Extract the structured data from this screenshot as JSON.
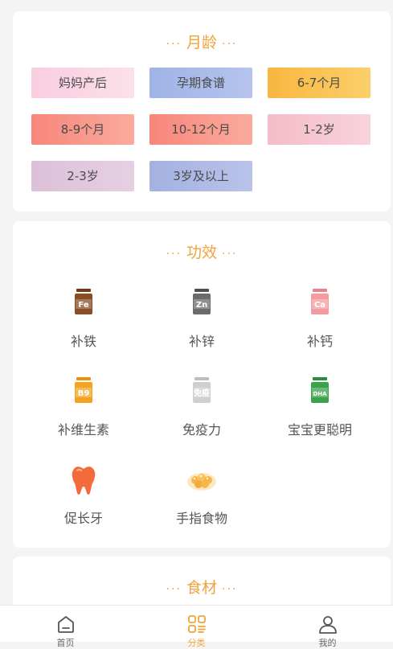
{
  "age_section": {
    "title": "月龄",
    "chips": [
      {
        "label": "妈妈产后",
        "color_from": "#f9cde0",
        "color_to": "#fbe0ea"
      },
      {
        "label": "孕期食谱",
        "color_from": "#9fb3e6",
        "color_to": "#b6c4ee"
      },
      {
        "label": "6-7个月",
        "color_from": "#f9b640",
        "color_to": "#fbcf6a"
      },
      {
        "label": "8-9个月",
        "color_from": "#f7867a",
        "color_to": "#fbaa9e"
      },
      {
        "label": "10-12个月",
        "color_from": "#f7867a",
        "color_to": "#fbaa9e"
      },
      {
        "label": "1-2岁",
        "color_from": "#f4bcc8",
        "color_to": "#f8d3dc"
      },
      {
        "label": "2-3岁",
        "color_from": "#dcc0d9",
        "color_to": "#e6cfe2"
      },
      {
        "label": "3岁及以上",
        "color_from": "#a4b1e0",
        "color_to": "#b9c3ea"
      }
    ]
  },
  "effect_section": {
    "title": "功效",
    "items": [
      {
        "label": "补铁",
        "icon": "iron-bottle-icon",
        "badge": "Fe",
        "color": "#8a4d24",
        "cap": "#6e3a18"
      },
      {
        "label": "补锌",
        "icon": "zinc-bottle-icon",
        "badge": "Zn",
        "color": "#6b6b6b",
        "cap": "#4f4f4f"
      },
      {
        "label": "补钙",
        "icon": "calcium-bottle-icon",
        "badge": "Ca",
        "color": "#f59aa1",
        "cap": "#ee8188"
      },
      {
        "label": "补维生素",
        "icon": "vitamin-bottle-icon",
        "badge": "B9",
        "color": "#f4a321",
        "cap": "#e99210"
      },
      {
        "label": "免疫力",
        "icon": "immunity-bottle-icon",
        "badge": "免疫",
        "color": "#cfcfcf",
        "cap": "#bdbdbd"
      },
      {
        "label": "宝宝更聪明",
        "icon": "dha-bottle-icon",
        "badge": "DHA",
        "color": "#3aa24a",
        "cap": "#2c8c3b"
      },
      {
        "label": "促长牙",
        "icon": "tooth-icon",
        "badge": "",
        "color": "#f46b3b",
        "cap": ""
      },
      {
        "label": "手指食物",
        "icon": "finger-food-icon",
        "badge": "",
        "color": "#f7b64a",
        "cap": ""
      }
    ]
  },
  "food_section": {
    "title": "食材"
  },
  "tabbar": {
    "active_color": "#f0a33a",
    "inactive_color": "#555555",
    "tabs": [
      {
        "label": "首页",
        "icon": "home-icon"
      },
      {
        "label": "分类",
        "icon": "category-icon"
      },
      {
        "label": "我的",
        "icon": "user-icon"
      }
    ]
  }
}
